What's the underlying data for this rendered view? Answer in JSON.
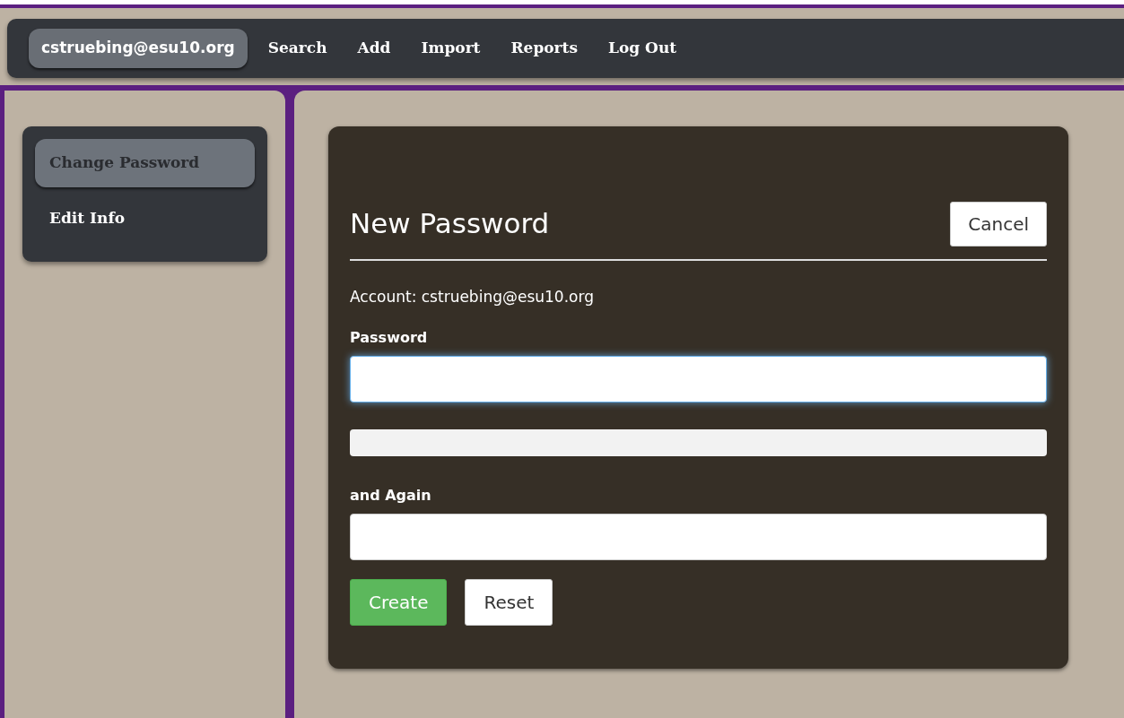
{
  "navbar": {
    "account": "cstruebing@esu10.org",
    "links": [
      {
        "label": "Search"
      },
      {
        "label": "Add"
      },
      {
        "label": "Import"
      },
      {
        "label": "Reports"
      },
      {
        "label": "Log Out"
      }
    ]
  },
  "sidebar": {
    "items": [
      {
        "label": "Change Password",
        "selected": true
      },
      {
        "label": "Edit Info",
        "selected": false
      }
    ]
  },
  "form": {
    "title": "New Password",
    "cancel": "Cancel",
    "account_line": "Account: cstruebing@esu10.org",
    "fields": [
      {
        "kind": "input",
        "label": "Password",
        "focused": true
      },
      {
        "kind": "meter",
        "level": 0
      },
      {
        "kind": "input",
        "label": "and Again",
        "focused": false
      }
    ],
    "buttons": [
      {
        "label": "Create",
        "kind": "primary"
      },
      {
        "label": "Reset",
        "kind": "secondary"
      }
    ]
  }
}
